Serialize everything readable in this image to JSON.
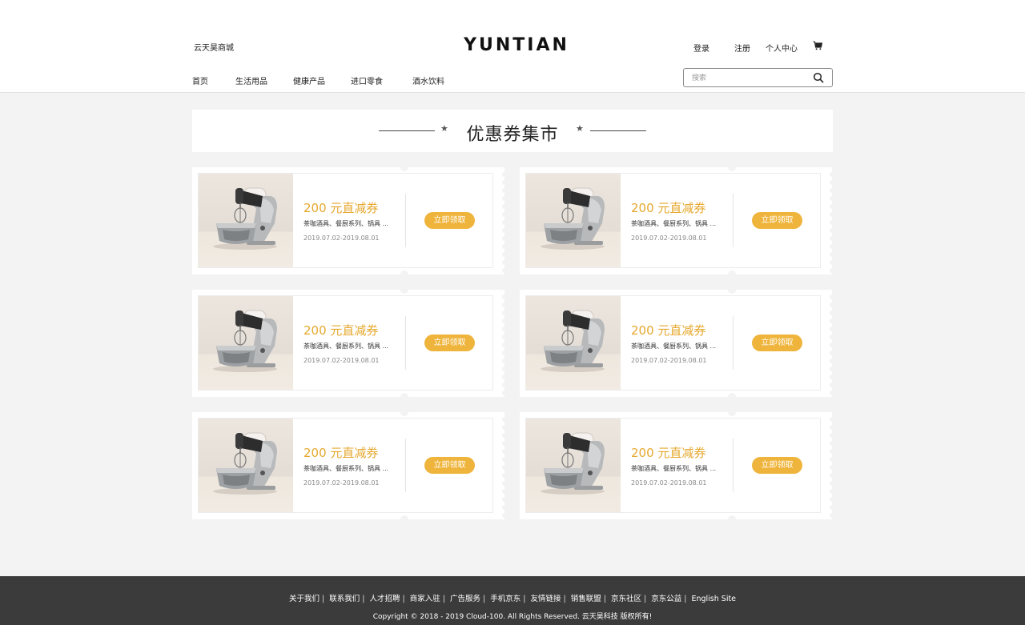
{
  "header": {
    "site_name": "云天昊商城",
    "logo": "YUNTIAN",
    "links": {
      "login": "登录",
      "register": "注册",
      "account": "个人中心"
    },
    "cart_icon": "cart-icon",
    "nav": [
      "首页",
      "生活用品",
      "健康产品",
      "进口零食",
      "酒水饮料"
    ],
    "search": {
      "placeholder": "搜索",
      "icon": "search-icon"
    }
  },
  "section_title": "优惠券集市",
  "coupons": [
    {
      "amount": "200 元直减券",
      "desc": "茶咖酒具、餐厨系列、锅具 ...",
      "date": "2019.07.02-2019.08.01",
      "button": "立即领取"
    },
    {
      "amount": "200 元直减券",
      "desc": "茶咖酒具、餐厨系列、锅具 ...",
      "date": "2019.07.02-2019.08.01",
      "button": "立即领取"
    },
    {
      "amount": "200 元直减券",
      "desc": "茶咖酒具、餐厨系列、锅具 ...",
      "date": "2019.07.02-2019.08.01",
      "button": "立即领取"
    },
    {
      "amount": "200 元直减券",
      "desc": "茶咖酒具、餐厨系列、锅具 ...",
      "date": "2019.07.02-2019.08.01",
      "button": "立即领取"
    },
    {
      "amount": "200 元直减券",
      "desc": "茶咖酒具、餐厨系列、锅具 ...",
      "date": "2019.07.02-2019.08.01",
      "button": "立即领取"
    },
    {
      "amount": "200 元直减券",
      "desc": "茶咖酒具、餐厨系列、锅具 ...",
      "date": "2019.07.02-2019.08.01",
      "button": "立即领取"
    }
  ],
  "footer": {
    "links": [
      "关于我们",
      "联系我们",
      "人才招聘",
      "商家入驻",
      "广告服务",
      "手机京东",
      "友情链接",
      "销售联盟",
      "京东社区",
      "京东公益",
      "English Site"
    ],
    "copyright": "Copyright © 2018 - 2019 Cloud-100. All Rights Reserved. 云天昊科技 版权所有!"
  },
  "colors": {
    "accent": "#efb43b",
    "amount_text": "#e6a82e",
    "footer_bg": "#3b3b3b",
    "page_bg": "#f3f3f3"
  }
}
